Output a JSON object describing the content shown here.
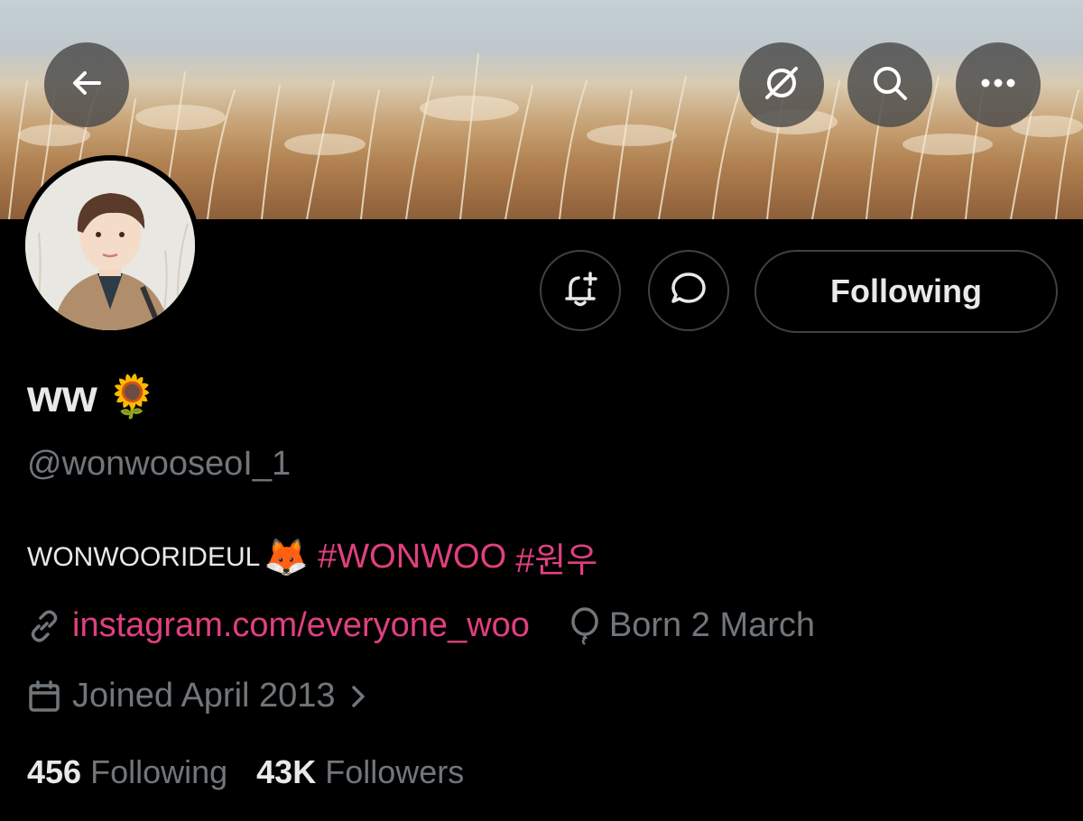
{
  "profile": {
    "display_name": "ww",
    "name_emoji": "🌻",
    "handle": "@wonwooseoI_1",
    "bio_text": "WONWOORIDEUL",
    "bio_emoji": "🦊",
    "hashtags": [
      "#WONWOO",
      "#원우"
    ],
    "website": "instagram.com/everyone_woo",
    "birthday": "Born 2 March",
    "joined": "Joined April 2013",
    "following_count": "456",
    "following_label": "Following",
    "followers_count": "43K",
    "followers_label": "Followers"
  },
  "actions": {
    "follow_label": "Following"
  },
  "icons": {
    "back": "back-arrow-icon",
    "grok": "grok-icon",
    "search": "search-icon",
    "more": "more-icon",
    "notify": "bell-plus-icon",
    "message": "message-bubble-icon",
    "link": "link-icon",
    "birthday": "balloon-icon",
    "calendar": "calendar-icon",
    "chevron": "chevron-right-icon"
  },
  "colors": {
    "background": "#000000",
    "text_primary": "#e7e9ea",
    "text_secondary": "#71767b",
    "accent": "#e0407e",
    "border": "#3e4144"
  }
}
